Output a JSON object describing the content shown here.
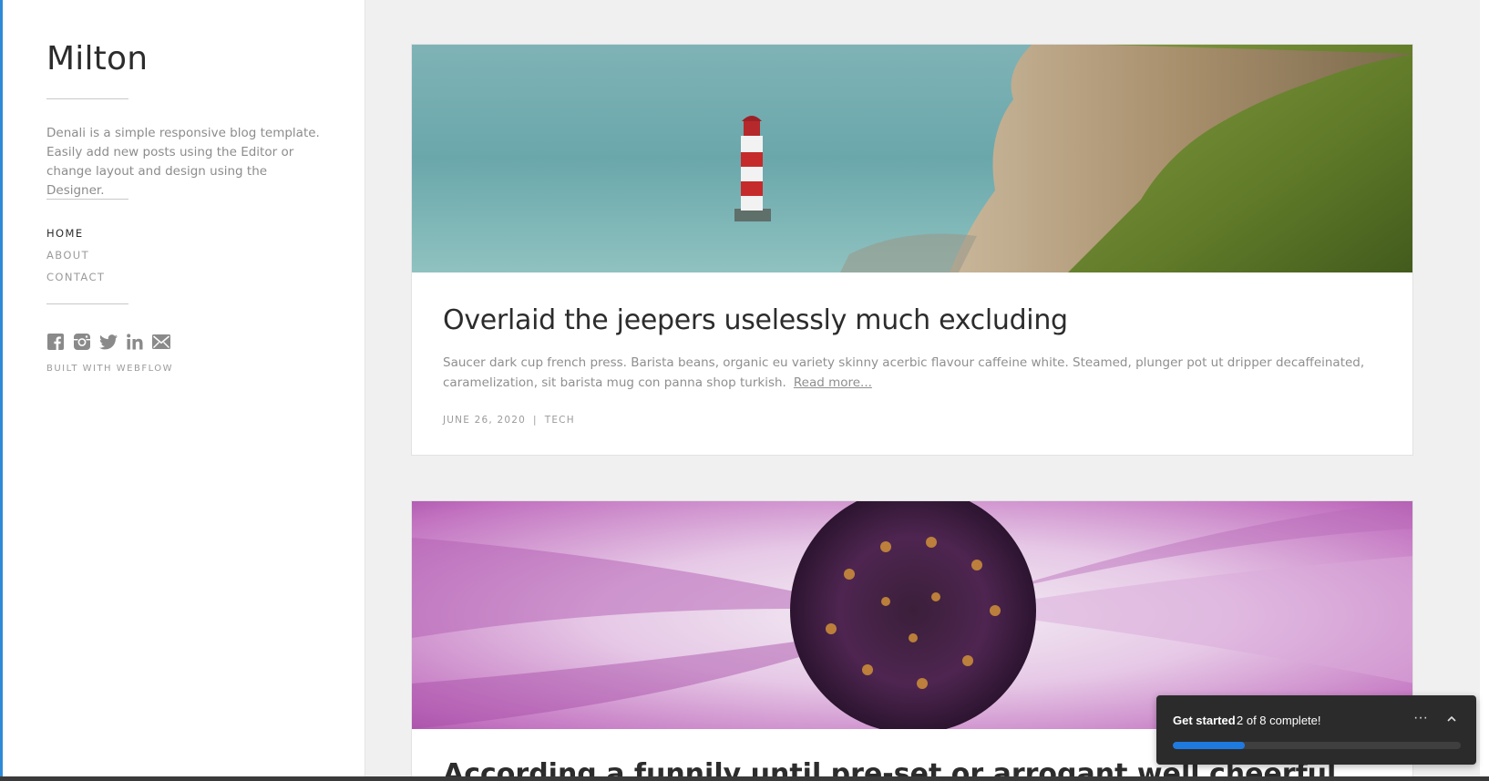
{
  "sidebar": {
    "site_title": "Milton",
    "description": "Denali is a simple responsive blog template. Easily add new posts using the Editor or change layout and design using the Designer.",
    "nav": [
      {
        "label": "HOME",
        "active": true
      },
      {
        "label": "ABOUT",
        "active": false
      },
      {
        "label": "CONTACT",
        "active": false
      }
    ],
    "social_icons": [
      "facebook-icon",
      "instagram-icon",
      "twitter-icon",
      "linkedin-icon",
      "email-icon"
    ],
    "built_with": "BUILT WITH WEBFLOW"
  },
  "posts": [
    {
      "title": "Overlaid the jeepers uselessly much excluding",
      "excerpt": "Saucer dark cup french press. Barista beans, organic eu variety skinny acerbic flavour caffeine white. Steamed, plunger pot ut dripper decaffeinated, caramelization, sit barista mug con panna shop turkish.",
      "read_more": "Read more...",
      "date": "JUNE 26, 2020",
      "separator": "|",
      "category": "TECH",
      "image": "lighthouse-cliff-photo"
    },
    {
      "title": "According a funnily until pre-set or arrogant well cheerful",
      "image": "purple-daisy-photo"
    }
  ],
  "widget": {
    "title": "Get started",
    "progress_text": "2 of 8 complete!",
    "completed": 2,
    "total": 8,
    "more_label": "···",
    "accent": "#1f7ae0"
  },
  "colors": {
    "frame_accent": "#2e8ad8",
    "page_background": "#f0f0f0"
  }
}
